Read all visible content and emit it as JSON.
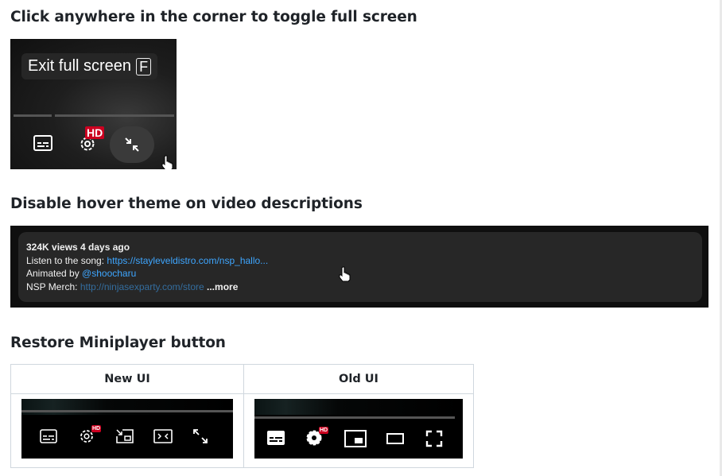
{
  "headings": {
    "fullscreen": "Click anywhere in the corner to toggle full screen",
    "description": "Disable hover theme on video descriptions",
    "miniplayer": "Restore Miniplayer button"
  },
  "fullscreen_demo": {
    "tooltip_text": "Exit full screen",
    "tooltip_key": "F",
    "hd_badge": "HD",
    "icons": [
      "subtitles-icon",
      "settings-gear-icon",
      "exit-fullscreen-icon"
    ]
  },
  "description_demo": {
    "stats": "324K views  4 days ago",
    "line2_prefix": "Listen to the song: ",
    "line2_link": "https://stayleveldistro.com/nsp_hallo...",
    "line3_prefix": "Animated by ",
    "line3_link": "@shoocharu",
    "line4_prefix": "NSP Merch: ",
    "line4_link": "http://ninjasexparty.com/store",
    "more": "...more"
  },
  "comparison_table": {
    "headers": [
      "New UI",
      "Old UI"
    ],
    "new_ui_icons": [
      "subtitles-icon",
      "settings-icon",
      "miniplayer-icon",
      "theater-mode-icon",
      "fullscreen-icon"
    ],
    "old_ui_icons": [
      "subtitles-icon",
      "settings-icon",
      "miniplayer-icon",
      "theater-mode-icon",
      "fullscreen-icon"
    ],
    "hd_badge": "HD"
  },
  "colors": {
    "youtube_red": "#cc0020",
    "link_blue": "#3ea6ff",
    "desc_bg": "#272727",
    "player_bg": "#0f0f0f"
  }
}
